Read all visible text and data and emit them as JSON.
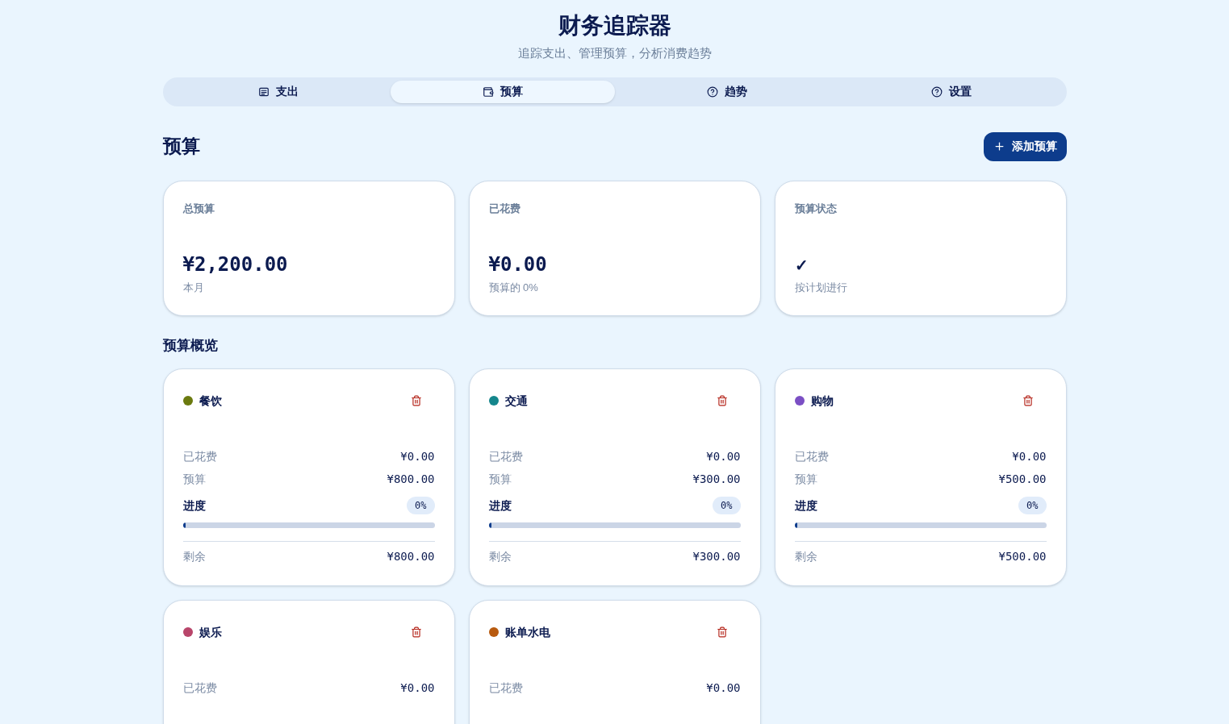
{
  "header": {
    "title": "财务追踪器",
    "subtitle": "追踪支出、管理预算，分析消费趋势"
  },
  "tabs": [
    {
      "label": "支出",
      "kind": "list",
      "selected": false
    },
    {
      "label": "预算",
      "kind": "wallet",
      "selected": true
    },
    {
      "label": "趋势",
      "kind": "help",
      "selected": false
    },
    {
      "label": "设置",
      "kind": "help",
      "selected": false
    }
  ],
  "section": {
    "title": "预算",
    "add_button": "添加预算"
  },
  "summary": [
    {
      "label": "总预算",
      "value": "¥2,200.00",
      "note": "本月",
      "kind": "amount"
    },
    {
      "label": "已花费",
      "value": "¥0.00",
      "note": "预算的 0%",
      "kind": "amount"
    },
    {
      "label": "预算状态",
      "value": "✓",
      "note": "按计划进行",
      "kind": "status"
    }
  ],
  "overview_title": "预算概览",
  "budgets": [
    {
      "name": "餐饮",
      "color": "#6b7a0f",
      "rows": [
        {
          "label": "已花费",
          "value": "¥0.00"
        },
        {
          "label": "预算",
          "value": "¥800.00"
        }
      ],
      "progress": {
        "label": "进度",
        "percent": "0%",
        "level": 0
      },
      "remaining": {
        "label": "剩余",
        "value": "¥800.00"
      }
    },
    {
      "name": "交通",
      "color": "#14868c",
      "rows": [
        {
          "label": "已花费",
          "value": "¥0.00"
        },
        {
          "label": "预算",
          "value": "¥300.00"
        }
      ],
      "progress": {
        "label": "进度",
        "percent": "0%",
        "level": 0
      },
      "remaining": {
        "label": "剩余",
        "value": "¥300.00"
      }
    },
    {
      "name": "购物",
      "color": "#7b4fc4",
      "rows": [
        {
          "label": "已花费",
          "value": "¥0.00"
        },
        {
          "label": "预算",
          "value": "¥500.00"
        }
      ],
      "progress": {
        "label": "进度",
        "percent": "0%",
        "level": 0
      },
      "remaining": {
        "label": "剩余",
        "value": "¥500.00"
      }
    },
    {
      "name": "娱乐",
      "color": "#b8456a",
      "rows": [
        {
          "label": "已花费",
          "value": "¥0.00"
        }
      ]
    },
    {
      "name": "账单水电",
      "color": "#b85a0f",
      "rows": [
        {
          "label": "已花费",
          "value": "¥0.00"
        }
      ]
    }
  ]
}
